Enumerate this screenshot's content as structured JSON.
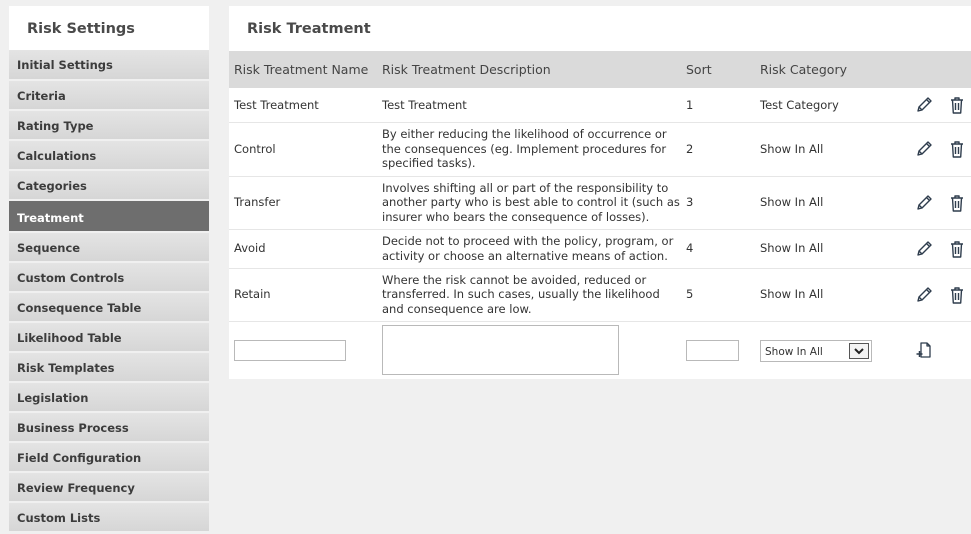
{
  "sidebar": {
    "title": "Risk Settings",
    "items": [
      {
        "label": "Initial Settings"
      },
      {
        "label": "Criteria"
      },
      {
        "label": "Rating Type"
      },
      {
        "label": "Calculations"
      },
      {
        "label": "Categories"
      },
      {
        "label": "Treatment",
        "active": true
      },
      {
        "label": "Sequence"
      },
      {
        "label": "Custom Controls"
      },
      {
        "label": "Consequence Table"
      },
      {
        "label": "Likelihood Table"
      },
      {
        "label": "Risk Templates"
      },
      {
        "label": "Legislation"
      },
      {
        "label": "Business Process"
      },
      {
        "label": "Field Configuration"
      },
      {
        "label": "Review Frequency"
      },
      {
        "label": "Custom Lists"
      }
    ]
  },
  "main": {
    "title": "Risk Treatment",
    "columns": {
      "name": "Risk Treatment Name",
      "description": "Risk Treatment Description",
      "sort": "Sort",
      "category": "Risk Category"
    },
    "rows": [
      {
        "name": "Test Treatment",
        "description": "Test Treatment",
        "sort": "1",
        "category": "Test Category"
      },
      {
        "name": "Control",
        "description": "By either reducing the likelihood of occurrence or the consequences (eg. Implement procedures for specified tasks).",
        "sort": "2",
        "category": "Show In All"
      },
      {
        "name": "Transfer",
        "description": "Involves shifting all or part of the responsibility to another party who is best able to control it (such as insurer who bears the consequence of losses).",
        "sort": "3",
        "category": "Show In All"
      },
      {
        "name": "Avoid",
        "description": "Decide not to proceed with the policy, program, or activity or choose an alternative means of action.",
        "sort": "4",
        "category": "Show In All"
      },
      {
        "name": "Retain",
        "description": "Where the risk cannot be avoided, reduced or transferred. In such cases, usually the likelihood and consequence are low.",
        "sort": "5",
        "category": "Show In All"
      }
    ],
    "new_row": {
      "name_value": "",
      "description_value": "",
      "sort_value": "",
      "category_selected": "Show In All"
    }
  },
  "icons": {
    "edit": "pencil-icon",
    "delete": "trash-icon",
    "add": "add-document-icon"
  },
  "colors": {
    "active_sidebar": "#6e6e6e",
    "header_bg": "#dadada",
    "icon": "#2f3d4d"
  }
}
